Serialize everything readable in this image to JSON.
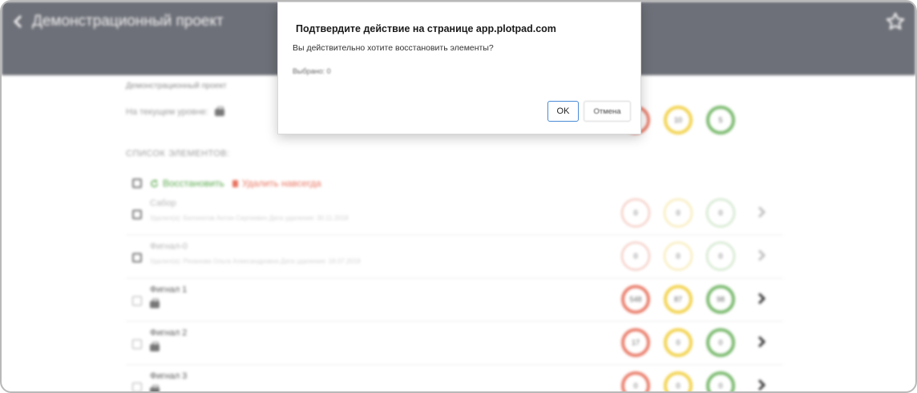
{
  "header": {
    "title": "Демонстрационный проект",
    "back_icon": "chevron-left-icon",
    "favorite_icon": "star-icon"
  },
  "content": {
    "breadcrumb": "Демонстрационный проект",
    "current_level": "На текущем уровне:",
    "current_badges": {
      "yellow": "10",
      "green": "5"
    },
    "list_heading": "СПИСОК ЭЛЕМЕНТОВ:",
    "restore_label": "Восстановить",
    "delete_label": "Удалить навсегда"
  },
  "rows": [
    {
      "name": "Сабор",
      "sub": "Удалил(а): Белоногов Антон Сергеевич Дата удаления: 30.11.2018",
      "badges": [
        "0",
        "0",
        "0"
      ],
      "faded": true
    },
    {
      "name": "Фигнал-0",
      "sub": "Удалил(а): Рязанова Ольга Александровна Дата удаления: 18.07.2019",
      "badges": [
        "0",
        "0",
        "0"
      ],
      "faded": true
    },
    {
      "name": "Фигнал 1",
      "sub": "",
      "badges": [
        "548",
        "87",
        "98"
      ],
      "faded": false
    },
    {
      "name": "Фигнал 2",
      "sub": "",
      "badges": [
        "17",
        "0",
        "0"
      ],
      "faded": false
    },
    {
      "name": "Фигнал 3",
      "sub": "",
      "badges": [
        "0",
        "0",
        "0"
      ],
      "faded": false
    }
  ],
  "dialog": {
    "title": "Подтвердите действие на странице app.plotpad.com",
    "message": "Вы действительно хотите восстановить элементы?",
    "extra": "Выбрано: 0",
    "ok_label": "OK",
    "cancel_label": "Отмена"
  },
  "colors": {
    "header_bg": "#6e7079",
    "red": "#e97c69",
    "yellow": "#f2d24c",
    "green": "#77b86a",
    "ok_border": "#4a8bd6"
  }
}
